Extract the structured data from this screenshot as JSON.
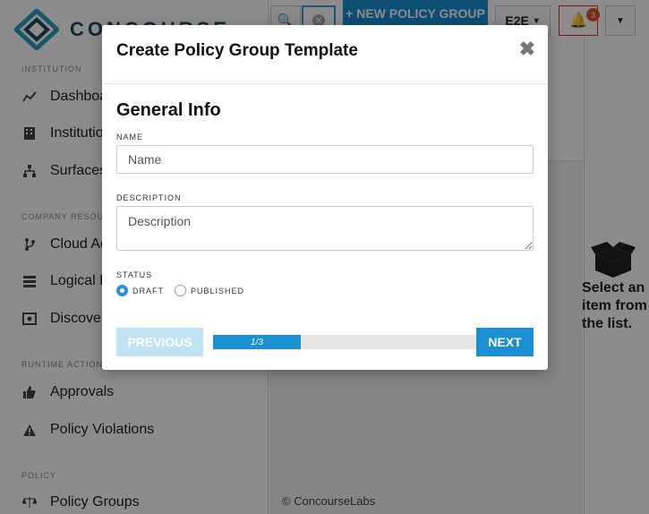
{
  "app": {
    "logo_text": "CONCOURSE",
    "search_icon": "search-icon",
    "new_policy_label": "+ NEW POLICY GROUP TEMPLATE",
    "env_label": "E2E",
    "notification_count": "3",
    "footer": "© ConcourseLabs"
  },
  "sidebar": {
    "sections": {
      "institution": "INSTITUTION",
      "company_resources": "COMPANY RESOURCES",
      "runtime_actions": "RUNTIME ACTIONS",
      "policy": "POLICY"
    },
    "items": [
      {
        "label": "Dashboard",
        "icon": "chart-icon"
      },
      {
        "label": "Institution",
        "icon": "building-icon"
      },
      {
        "label": "Surfaces",
        "icon": "hierarchy-icon"
      },
      {
        "label": "Cloud Accounts",
        "icon": "branch-icon"
      },
      {
        "label": "Logical Deployments",
        "icon": "server-icon"
      },
      {
        "label": "Discovered",
        "icon": "discover-icon"
      },
      {
        "label": "Approvals",
        "icon": "thumbs-up-icon"
      },
      {
        "label": "Policy Violations",
        "icon": "warning-icon"
      },
      {
        "label": "Policy Groups",
        "icon": "scale-icon"
      }
    ]
  },
  "right_panel": {
    "empty_text": "Select an item from the list."
  },
  "modal": {
    "title": "Create Policy Group Template",
    "close_label": "✖",
    "section_title": "General Info",
    "name_label": "NAME",
    "name_placeholder": "Name",
    "description_label": "DESCRIPTION",
    "description_placeholder": "Description",
    "status_label": "STATUS",
    "status_options": [
      "DRAFT",
      "PUBLISHED"
    ],
    "status_selected": "DRAFT",
    "previous_label": "PREVIOUS",
    "next_label": "NEXT",
    "progress_text": "1/3",
    "progress_fraction": 0.333
  }
}
